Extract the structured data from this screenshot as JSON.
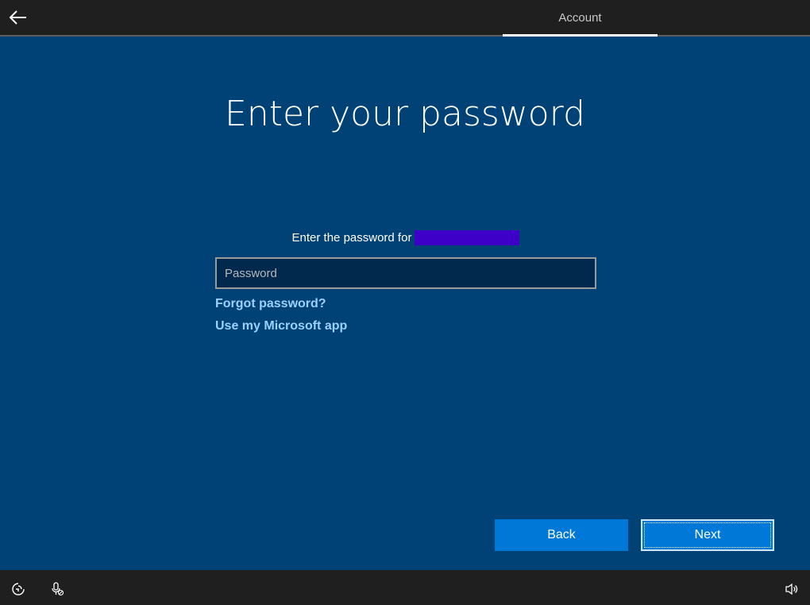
{
  "header": {
    "tab_label": "Account",
    "back_icon": "back-arrow-icon"
  },
  "main": {
    "title": "Enter your password",
    "prompt_text": "Enter the password for",
    "password_placeholder": "Password",
    "password_value": "",
    "links": {
      "forgot": "Forgot password?",
      "microsoft_app": "Use my Microsoft app"
    }
  },
  "footer": {
    "back_label": "Back",
    "next_label": "Next",
    "icons": [
      "ease-of-access-icon",
      "microphone-icon",
      "volume-icon"
    ]
  },
  "colors": {
    "background": "#004275",
    "bar": "#1f1f1f",
    "accent_button": "#0078d7",
    "link": "#9bd0ff",
    "redaction": "#3e00c8"
  }
}
